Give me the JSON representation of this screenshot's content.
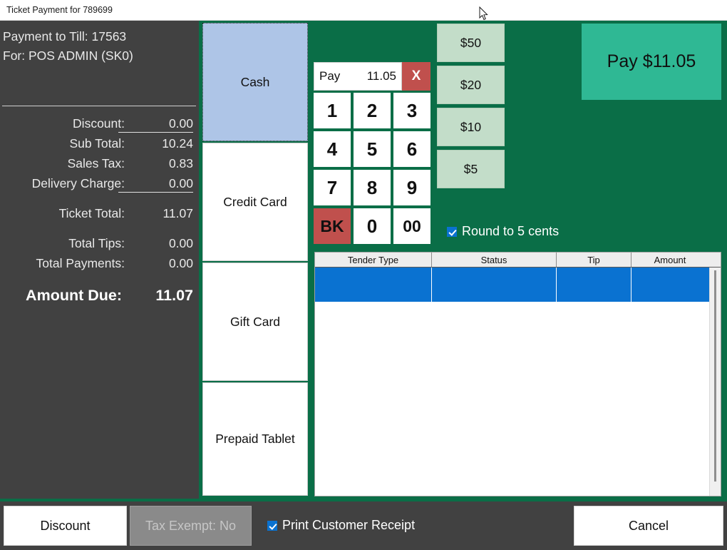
{
  "window": {
    "title": "Ticket Payment for 789699"
  },
  "summary": {
    "till_line": "Payment to Till: 17563",
    "for_line": "For: POS ADMIN  (SK0)",
    "rows": [
      {
        "label": "Discount:",
        "value": "0.00"
      },
      {
        "label": "Sub Total:",
        "value": "10.24"
      },
      {
        "label": "Sales Tax:",
        "value": "0.83"
      },
      {
        "label": "Delivery Charge:",
        "value": "0.00"
      },
      {
        "label": "Ticket Total:",
        "value": "11.07"
      },
      {
        "label": "Total Tips:",
        "value": "0.00"
      },
      {
        "label": "Total Payments:",
        "value": "0.00"
      },
      {
        "label": "Amount Due:",
        "value": "11.07"
      }
    ]
  },
  "payment_methods": [
    {
      "label": "Cash",
      "selected": true
    },
    {
      "label": "Credit Card",
      "selected": false
    },
    {
      "label": "Gift Card",
      "selected": false
    },
    {
      "label": "Prepaid Tablet",
      "selected": false
    }
  ],
  "keypad": {
    "pay_label": "Pay",
    "pay_value": "11.05",
    "clear_label": "X",
    "keys": [
      "1",
      "2",
      "3",
      "4",
      "5",
      "6",
      "7",
      "8",
      "9",
      "BK",
      "0",
      "00"
    ]
  },
  "quick_cash": [
    {
      "label": "$50"
    },
    {
      "label": "$20"
    },
    {
      "label": "$10"
    },
    {
      "label": "$5"
    }
  ],
  "round_option": {
    "label": "Round to 5 cents",
    "checked": true
  },
  "pay_button": {
    "label": "Pay $11.05",
    "color": "#2fb894"
  },
  "tender_table": {
    "columns": [
      "Tender Type",
      "Status",
      "Tip",
      "Amount"
    ],
    "rows": [
      {
        "tender_type": "",
        "status": "",
        "tip": "",
        "amount": "",
        "selected": true
      }
    ]
  },
  "bottom_bar": {
    "discount_label": "Discount",
    "tax_exempt_label": "Tax Exempt: No",
    "print_receipt_label": "Print Customer Receipt",
    "print_receipt_checked": true,
    "cancel_label": "Cancel"
  },
  "colors": {
    "green_background": "#0a6e47",
    "panel_dark": "#414141",
    "selected_blue": "#aec5e7",
    "row_blue": "#0a72d1",
    "accent_red": "#c0504d",
    "quick_cash": "#c3ddc9",
    "pay_teal": "#2fb894"
  }
}
